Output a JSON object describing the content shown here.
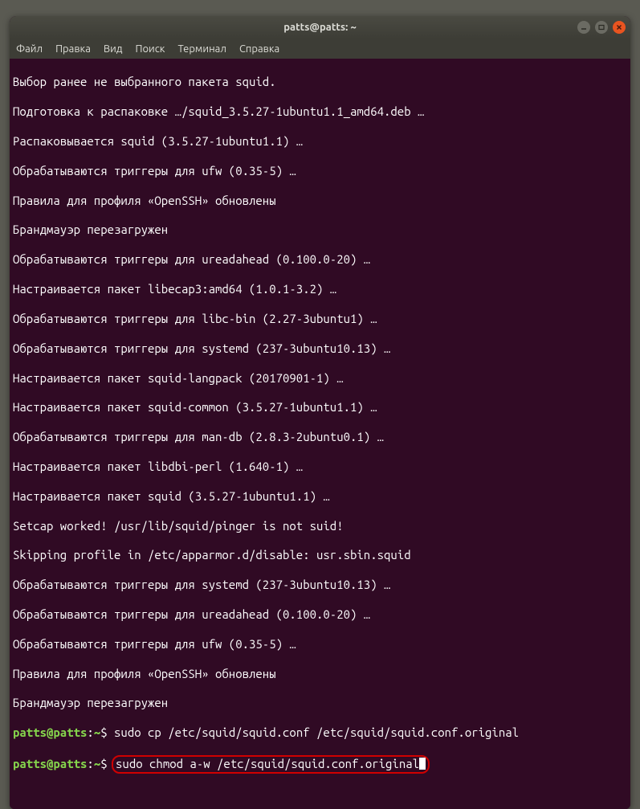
{
  "window": {
    "title": "patts@patts: ~"
  },
  "menubar": {
    "file": "Файл",
    "edit": "Правка",
    "view": "Вид",
    "search": "Поиск",
    "terminal": "Терминал",
    "help": "Справка"
  },
  "output": {
    "l1": "Выбор ранее не выбранного пакета squid.",
    "l2": "Подготовка к распаковке …/squid_3.5.27-1ubuntu1.1_amd64.deb …",
    "l3": "Распаковывается squid (3.5.27-1ubuntu1.1) …",
    "l4": "Обрабатываются триггеры для ufw (0.35-5) …",
    "l5": "Правила для профиля «OpenSSH» обновлены",
    "l6": "Брандмауэр перезагружен",
    "l7": "Обрабатываются триггеры для ureadahead (0.100.0-20) …",
    "l8": "Настраивается пакет libecap3:amd64 (1.0.1-3.2) …",
    "l9": "Обрабатываются триггеры для libc-bin (2.27-3ubuntu1) …",
    "l10": "Обрабатываются триггеры для systemd (237-3ubuntu10.13) …",
    "l11": "Настраивается пакет squid-langpack (20170901-1) …",
    "l12": "Настраивается пакет squid-common (3.5.27-1ubuntu1.1) …",
    "l13": "Обрабатываются триггеры для man-db (2.8.3-2ubuntu0.1) …",
    "l14": "Настраивается пакет libdbi-perl (1.640-1) …",
    "l15": "Настраивается пакет squid (3.5.27-1ubuntu1.1) …",
    "l16": "Setcap worked! /usr/lib/squid/pinger is not suid!",
    "l17": "Skipping profile in /etc/apparmor.d/disable: usr.sbin.squid",
    "l18": "Обрабатываются триггеры для systemd (237-3ubuntu10.13) …",
    "l19": "Обрабатываются триггеры для ureadahead (0.100.0-20) …",
    "l20": "Обрабатываются триггеры для ufw (0.35-5) …",
    "l21": "Правила для профиля «OpenSSH» обновлены",
    "l22": "Брандмауэр перезагружен"
  },
  "prompt1": {
    "user": "patts@patts",
    "colon": ":",
    "path": "~",
    "dollar": "$ ",
    "cmd": "sudo cp /etc/squid/squid.conf /etc/squid/squid.conf.original"
  },
  "prompt2": {
    "user": "patts@patts",
    "colon": ":",
    "path": "~",
    "dollar": "$ ",
    "cmd": "sudo chmod a-w /etc/squid/squid.conf.original"
  }
}
